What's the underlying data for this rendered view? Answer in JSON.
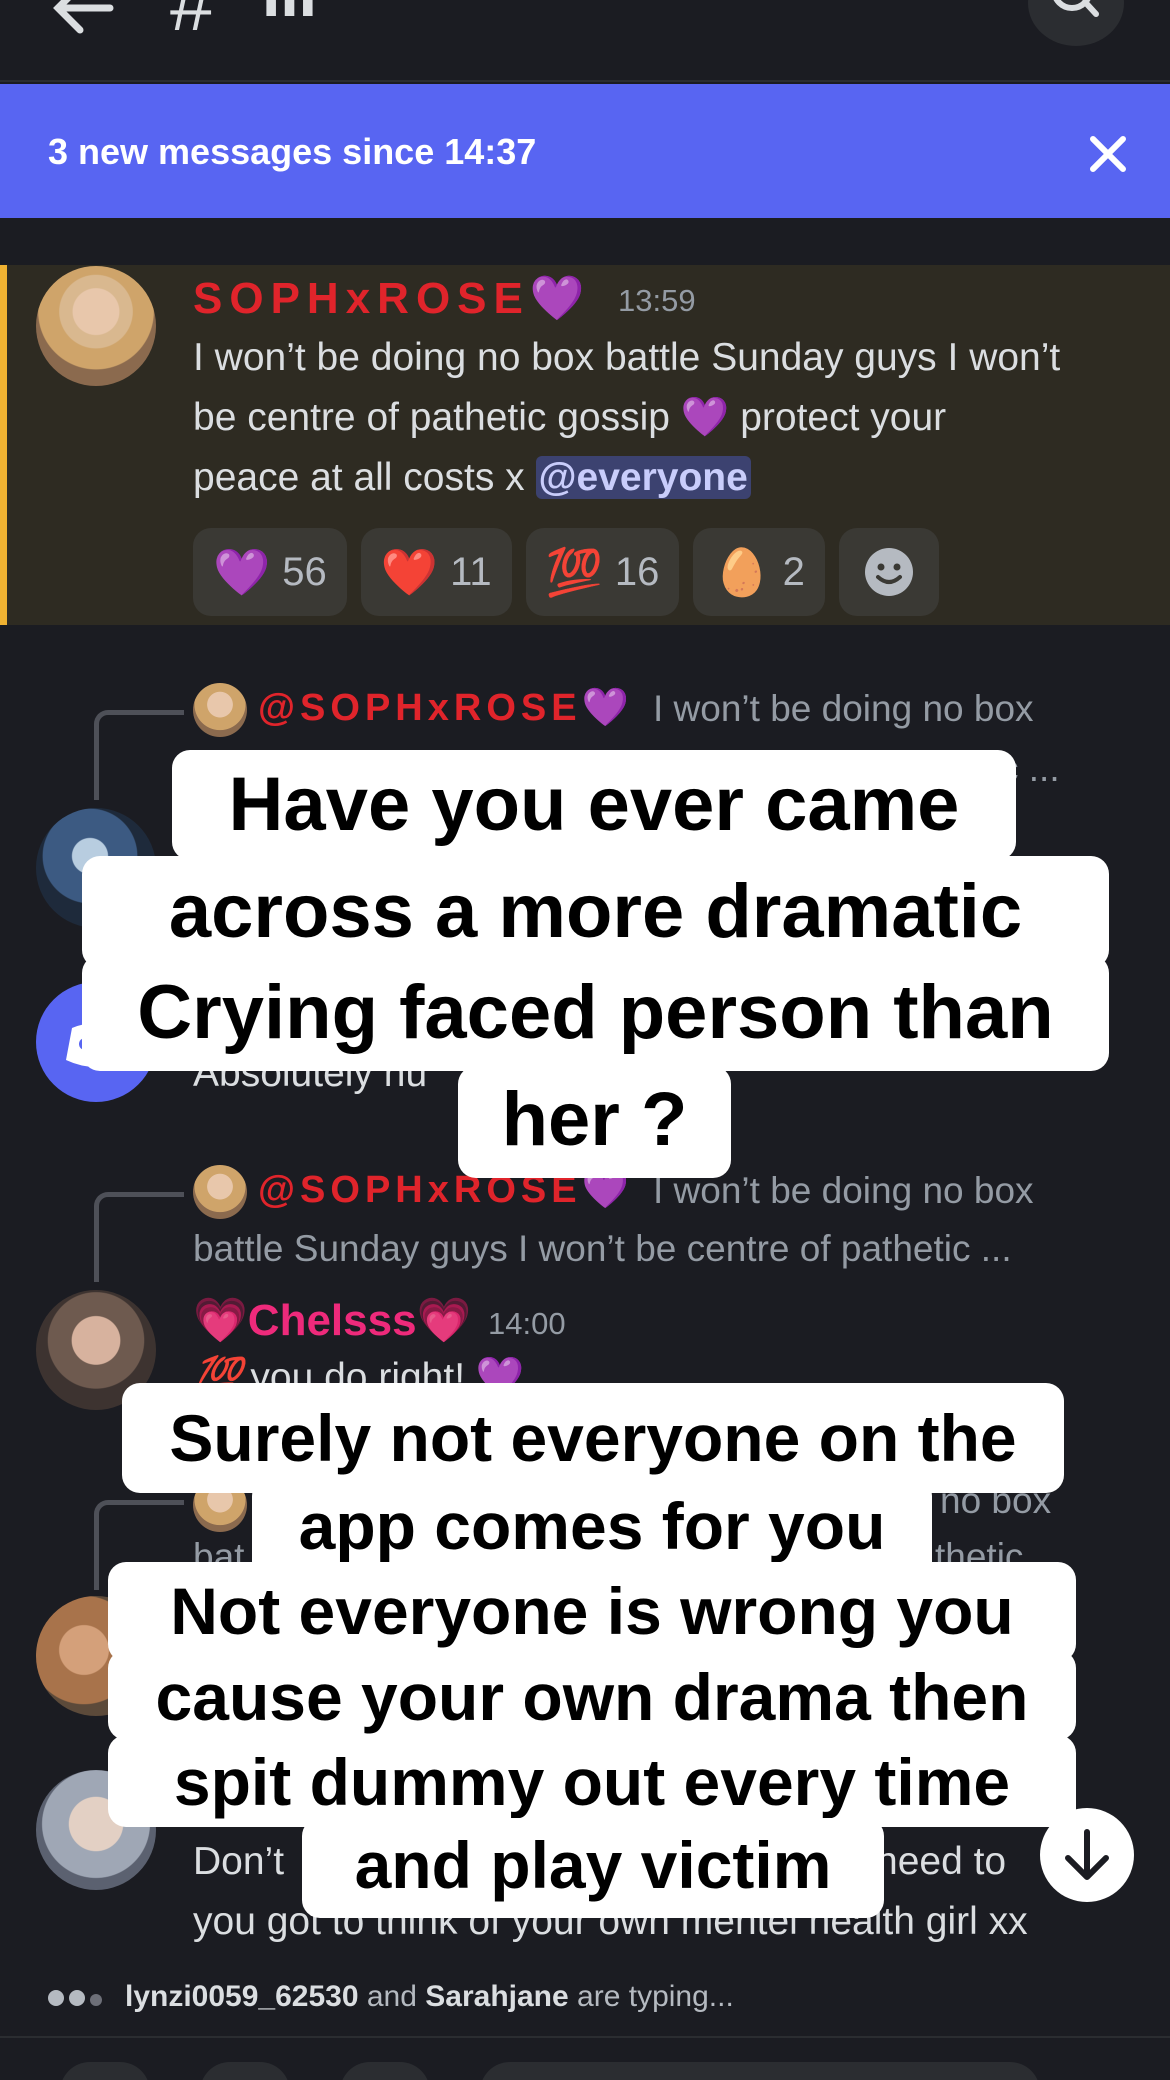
{
  "topbar": {
    "channel": "III",
    "hash": "#"
  },
  "banner": {
    "text": "3 new messages since 14:37",
    "close": "✕"
  },
  "main_message": {
    "author": "SOPHxROSE",
    "heart": "💜",
    "time": "13:59",
    "text_line1": "I won’t be doing no box battle Sunday guys I won’t",
    "text_line2a": "be centre of pathetic gossip",
    "text_line2b": "protect your",
    "text_line3": "peace at all costs x",
    "mention": "@everyone",
    "reactions": [
      {
        "emoji": "💜",
        "count": "56"
      },
      {
        "emoji": "❤️",
        "count": "11"
      },
      {
        "emoji": "💯",
        "count": "16"
      },
      {
        "emoji": "🥚",
        "count": "2"
      }
    ],
    "add_reaction_icon": "☻"
  },
  "reply1": {
    "author": "@SOPHxROSE",
    "heart": "💜",
    "text": "I won’t be doing no box",
    "text2": "c ..."
  },
  "reply2": {
    "author": "@SOPHxROSE",
    "heart": "💜",
    "text": "I won’t be doing no box",
    "line2": "battle Sunday guys I won’t be centre of pathetic ..."
  },
  "msg_discord": {
    "partial": "Absolutely nu"
  },
  "msg_chels": {
    "author": "Chelsss",
    "heart": "💗",
    "time": "14:00",
    "text": "you do right!"
  },
  "reply3": {
    "right1": "no box",
    "left2": "bat",
    "right2": "thetic ..."
  },
  "msg_last": {
    "part1": "Don’t",
    "part2": "need to",
    "line2": "you got to think of your own mentel health girl xx"
  },
  "captions": {
    "top": [
      "Have you ever came",
      "across a more dramatic",
      "Crying faced person than",
      "her ?"
    ],
    "bottom": [
      "Surely not everyone on the",
      "app comes for you",
      "Not everyone is wrong you",
      "cause your own drama then",
      "spit dummy out every time",
      "and play victim"
    ]
  },
  "typing": {
    "user1": "lynzi0059_62530",
    "and": "and",
    "user2": "Sarahjane",
    "suffix": "are typing..."
  }
}
